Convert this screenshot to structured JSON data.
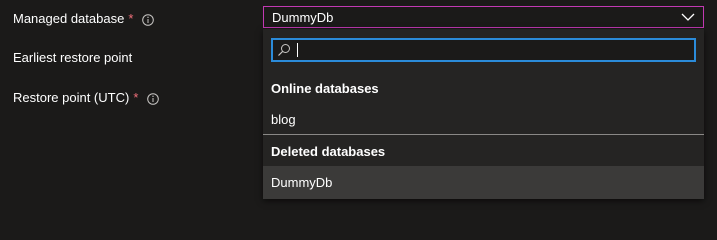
{
  "form": {
    "managed_database_label": "Managed database",
    "earliest_restore_label": "Earliest restore point",
    "restore_point_label": "Restore point (UTC)",
    "required_marker": "*"
  },
  "dropdown": {
    "selected_value": "DummyDb",
    "search_value": "",
    "search_placeholder": "",
    "groups": [
      {
        "header": "Online databases",
        "items": [
          "blog"
        ]
      },
      {
        "header": "Deleted databases",
        "items": [
          "DummyDb"
        ]
      }
    ]
  },
  "colors": {
    "background": "#1b1a19",
    "dropdown_border": "#c239b3",
    "search_border": "#2b8bd9",
    "required": "#f1707b",
    "selected_item": "#3b3a39"
  }
}
